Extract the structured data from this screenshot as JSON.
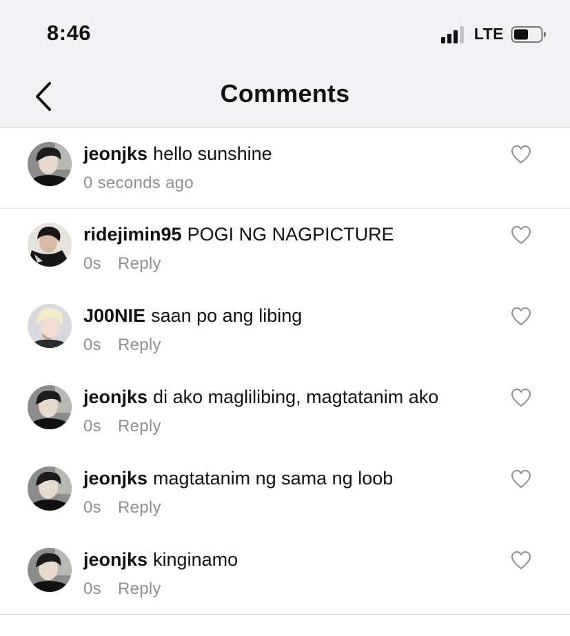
{
  "status_bar": {
    "time": "8:46",
    "network": "LTE",
    "signal_bars": 3,
    "signal_bars_total": 4,
    "battery_level": 0.45
  },
  "header": {
    "title": "Comments",
    "back_icon": "chevron-left-icon"
  },
  "comments": [
    {
      "username": "jeonjks",
      "text": "hello sunshine",
      "time": "0 seconds ago",
      "reply": "",
      "avatar": "dark-hair-avatar"
    },
    {
      "username": "ridejimin95",
      "text": "POGI NG NAGPICTURE",
      "time": "0s",
      "reply": "Reply",
      "avatar": "dark-hair-avatar"
    },
    {
      "username": "J00NIE",
      "text": "saan po ang libing",
      "time": "0s",
      "reply": "Reply",
      "avatar": "blond-hair-avatar"
    },
    {
      "username": "jeonjks",
      "text": "di ako maglilibing, magtatanim ako",
      "time": "0s",
      "reply": "Reply",
      "avatar": "dark-hair-avatar"
    },
    {
      "username": "jeonjks",
      "text": "magtatanim ng sama ng loob",
      "time": "0s",
      "reply": "Reply",
      "avatar": "dark-hair-avatar"
    },
    {
      "username": "jeonjks",
      "text": "kinginamo",
      "time": "0s",
      "reply": "Reply",
      "avatar": "dark-hair-avatar"
    }
  ],
  "colors": {
    "header_bg": "#f2f2f4",
    "secondary_text": "#8e8e93",
    "primary_text": "#111111"
  }
}
